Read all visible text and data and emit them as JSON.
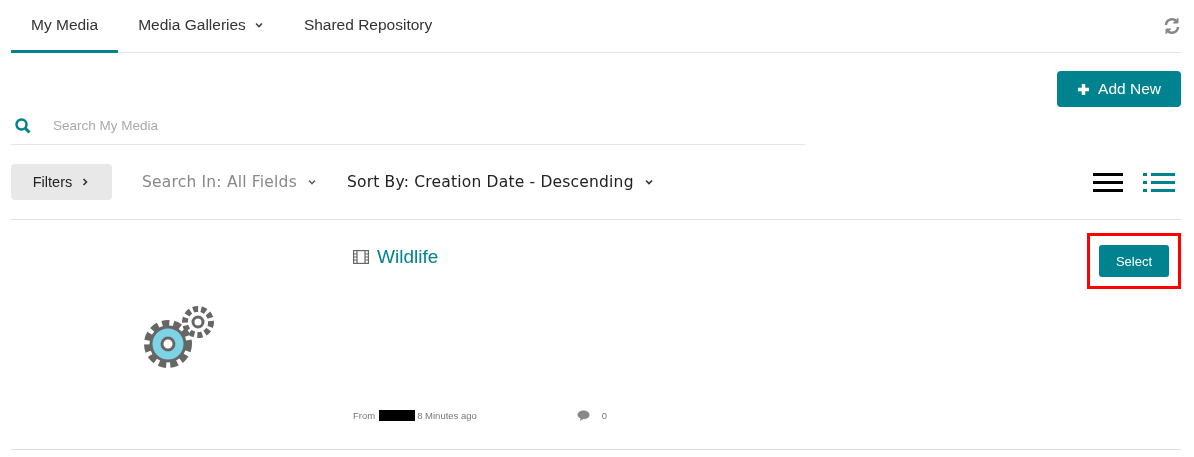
{
  "tabs": [
    {
      "label": "My Media",
      "selected": true,
      "dropdown": false
    },
    {
      "label": "Media Galleries",
      "selected": false,
      "dropdown": true
    },
    {
      "label": "Shared Repository",
      "selected": false,
      "dropdown": false
    }
  ],
  "add_button": {
    "label": "Add New"
  },
  "search": {
    "placeholder": "Search My Media"
  },
  "toolbar": {
    "filters": "Filters",
    "search_in": "Search In: All Fields",
    "sort_by": "Sort By: Creation Date - Descending"
  },
  "views": [
    {
      "kind": "list",
      "selected": false
    },
    {
      "kind": "detailed",
      "selected": true
    }
  ],
  "entries": [
    {
      "title": "Wildlife",
      "from": "From",
      "time": "8 Minutes ago",
      "comments": "0",
      "action": "Select",
      "highlighted": true
    }
  ]
}
